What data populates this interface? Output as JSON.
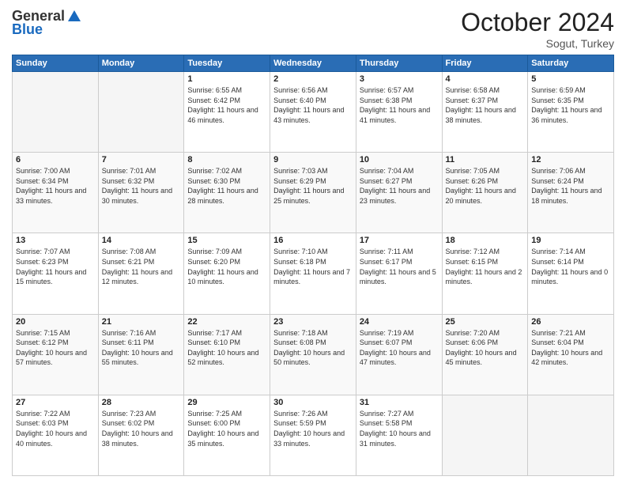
{
  "header": {
    "logo": {
      "general": "General",
      "blue": "Blue"
    },
    "title": "October 2024",
    "location": "Sogut, Turkey"
  },
  "weekdays": [
    "Sunday",
    "Monday",
    "Tuesday",
    "Wednesday",
    "Thursday",
    "Friday",
    "Saturday"
  ],
  "weeks": [
    [
      {
        "day": "",
        "info": ""
      },
      {
        "day": "",
        "info": ""
      },
      {
        "day": "1",
        "info": "Sunrise: 6:55 AM\nSunset: 6:42 PM\nDaylight: 11 hours and 46 minutes."
      },
      {
        "day": "2",
        "info": "Sunrise: 6:56 AM\nSunset: 6:40 PM\nDaylight: 11 hours and 43 minutes."
      },
      {
        "day": "3",
        "info": "Sunrise: 6:57 AM\nSunset: 6:38 PM\nDaylight: 11 hours and 41 minutes."
      },
      {
        "day": "4",
        "info": "Sunrise: 6:58 AM\nSunset: 6:37 PM\nDaylight: 11 hours and 38 minutes."
      },
      {
        "day": "5",
        "info": "Sunrise: 6:59 AM\nSunset: 6:35 PM\nDaylight: 11 hours and 36 minutes."
      }
    ],
    [
      {
        "day": "6",
        "info": "Sunrise: 7:00 AM\nSunset: 6:34 PM\nDaylight: 11 hours and 33 minutes."
      },
      {
        "day": "7",
        "info": "Sunrise: 7:01 AM\nSunset: 6:32 PM\nDaylight: 11 hours and 30 minutes."
      },
      {
        "day": "8",
        "info": "Sunrise: 7:02 AM\nSunset: 6:30 PM\nDaylight: 11 hours and 28 minutes."
      },
      {
        "day": "9",
        "info": "Sunrise: 7:03 AM\nSunset: 6:29 PM\nDaylight: 11 hours and 25 minutes."
      },
      {
        "day": "10",
        "info": "Sunrise: 7:04 AM\nSunset: 6:27 PM\nDaylight: 11 hours and 23 minutes."
      },
      {
        "day": "11",
        "info": "Sunrise: 7:05 AM\nSunset: 6:26 PM\nDaylight: 11 hours and 20 minutes."
      },
      {
        "day": "12",
        "info": "Sunrise: 7:06 AM\nSunset: 6:24 PM\nDaylight: 11 hours and 18 minutes."
      }
    ],
    [
      {
        "day": "13",
        "info": "Sunrise: 7:07 AM\nSunset: 6:23 PM\nDaylight: 11 hours and 15 minutes."
      },
      {
        "day": "14",
        "info": "Sunrise: 7:08 AM\nSunset: 6:21 PM\nDaylight: 11 hours and 12 minutes."
      },
      {
        "day": "15",
        "info": "Sunrise: 7:09 AM\nSunset: 6:20 PM\nDaylight: 11 hours and 10 minutes."
      },
      {
        "day": "16",
        "info": "Sunrise: 7:10 AM\nSunset: 6:18 PM\nDaylight: 11 hours and 7 minutes."
      },
      {
        "day": "17",
        "info": "Sunrise: 7:11 AM\nSunset: 6:17 PM\nDaylight: 11 hours and 5 minutes."
      },
      {
        "day": "18",
        "info": "Sunrise: 7:12 AM\nSunset: 6:15 PM\nDaylight: 11 hours and 2 minutes."
      },
      {
        "day": "19",
        "info": "Sunrise: 7:14 AM\nSunset: 6:14 PM\nDaylight: 11 hours and 0 minutes."
      }
    ],
    [
      {
        "day": "20",
        "info": "Sunrise: 7:15 AM\nSunset: 6:12 PM\nDaylight: 10 hours and 57 minutes."
      },
      {
        "day": "21",
        "info": "Sunrise: 7:16 AM\nSunset: 6:11 PM\nDaylight: 10 hours and 55 minutes."
      },
      {
        "day": "22",
        "info": "Sunrise: 7:17 AM\nSunset: 6:10 PM\nDaylight: 10 hours and 52 minutes."
      },
      {
        "day": "23",
        "info": "Sunrise: 7:18 AM\nSunset: 6:08 PM\nDaylight: 10 hours and 50 minutes."
      },
      {
        "day": "24",
        "info": "Sunrise: 7:19 AM\nSunset: 6:07 PM\nDaylight: 10 hours and 47 minutes."
      },
      {
        "day": "25",
        "info": "Sunrise: 7:20 AM\nSunset: 6:06 PM\nDaylight: 10 hours and 45 minutes."
      },
      {
        "day": "26",
        "info": "Sunrise: 7:21 AM\nSunset: 6:04 PM\nDaylight: 10 hours and 42 minutes."
      }
    ],
    [
      {
        "day": "27",
        "info": "Sunrise: 7:22 AM\nSunset: 6:03 PM\nDaylight: 10 hours and 40 minutes."
      },
      {
        "day": "28",
        "info": "Sunrise: 7:23 AM\nSunset: 6:02 PM\nDaylight: 10 hours and 38 minutes."
      },
      {
        "day": "29",
        "info": "Sunrise: 7:25 AM\nSunset: 6:00 PM\nDaylight: 10 hours and 35 minutes."
      },
      {
        "day": "30",
        "info": "Sunrise: 7:26 AM\nSunset: 5:59 PM\nDaylight: 10 hours and 33 minutes."
      },
      {
        "day": "31",
        "info": "Sunrise: 7:27 AM\nSunset: 5:58 PM\nDaylight: 10 hours and 31 minutes."
      },
      {
        "day": "",
        "info": ""
      },
      {
        "day": "",
        "info": ""
      }
    ]
  ]
}
